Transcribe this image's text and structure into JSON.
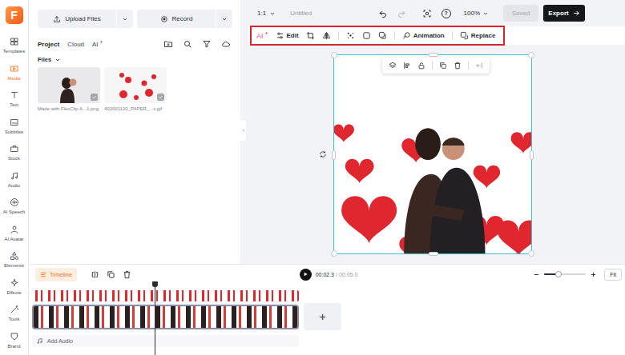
{
  "logo": "F",
  "sidebar": {
    "items": [
      {
        "label": "Templates",
        "selected": false
      },
      {
        "label": "Media",
        "selected": true
      },
      {
        "label": "Text",
        "selected": false
      },
      {
        "label": "Subtitles",
        "selected": false
      },
      {
        "label": "Stock",
        "selected": false
      },
      {
        "label": "Audio",
        "selected": false
      },
      {
        "label": "AI Speech",
        "selected": false
      },
      {
        "label": "AI Avatar",
        "selected": false
      },
      {
        "label": "Elements",
        "selected": false
      },
      {
        "label": "Effects",
        "selected": false
      },
      {
        "label": "Tools",
        "selected": false
      },
      {
        "label": "Brand",
        "selected": false
      }
    ]
  },
  "media_panel": {
    "buttons": [
      "Upload Files",
      "Record"
    ],
    "tabs": [
      {
        "label": "Project",
        "selected": true
      },
      {
        "label": "Cloud",
        "selected": false
      },
      {
        "label": "AI",
        "selected": false
      }
    ],
    "section": "Files",
    "files": [
      {
        "name": "Made with FlexClip A...1.png",
        "checked": true
      },
      {
        "name": "402001120_PAPER_...x.gif",
        "checked": true
      }
    ]
  },
  "top_bar": {
    "aspect": "1:1",
    "title": "Untitled",
    "help": "?",
    "zoom": "100%",
    "saved": {
      "label": "Saved",
      "disabled": true
    },
    "export": "Export"
  },
  "toolbar": {
    "ai": "AI",
    "edit": "Edit",
    "animation": "Animation",
    "replace": "Replace"
  },
  "timeline": {
    "label": "Timeline",
    "current_time": "00:02.3",
    "separator": "/",
    "total_time": "00:05.0",
    "progress": 0.46,
    "zoom_level": 0.35,
    "fit": "Fit",
    "add_clip": "+",
    "add_audio": "Add Audio"
  }
}
